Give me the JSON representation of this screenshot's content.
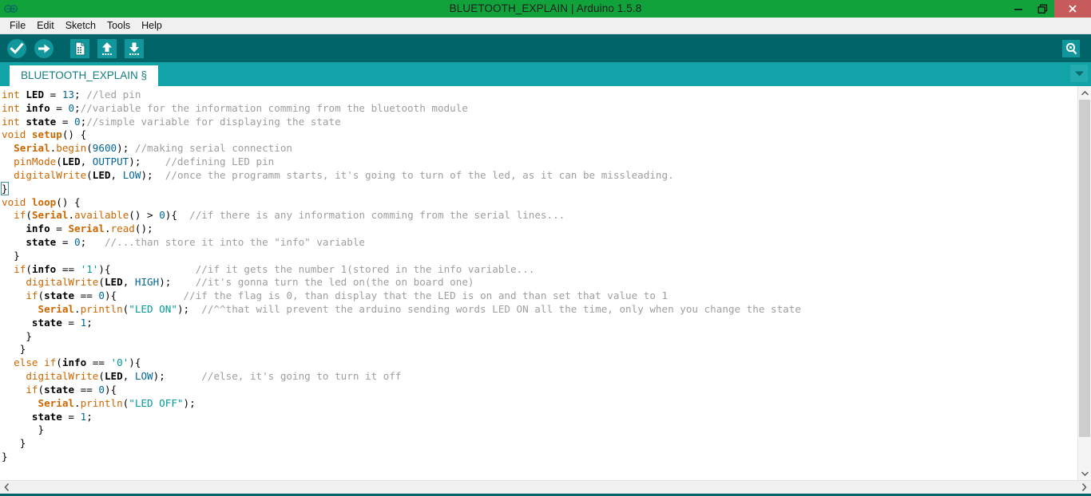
{
  "window": {
    "title": "BLUETOOTH_EXPLAIN | Arduino 1.5.8",
    "titlebar_color": "#11a23c",
    "logo_icon": "arduino-infinity-logo-icon",
    "controls": [
      {
        "name": "minimize",
        "icon": "minimize-icon"
      },
      {
        "name": "restore",
        "icon": "restore-icon"
      },
      {
        "name": "close",
        "icon": "close-icon",
        "color": "#c75b5b"
      }
    ]
  },
  "menubar": {
    "items": [
      {
        "label": "File"
      },
      {
        "label": "Edit"
      },
      {
        "label": "Sketch"
      },
      {
        "label": "Tools"
      },
      {
        "label": "Help"
      }
    ]
  },
  "toolbar": {
    "background": "#006468",
    "buttons": [
      {
        "name": "verify",
        "icon": "check-circle-icon",
        "title": "Verify"
      },
      {
        "name": "upload",
        "icon": "arrow-right-circle-icon",
        "title": "Upload"
      },
      {
        "name": "new",
        "icon": "new-document-icon",
        "title": "New"
      },
      {
        "name": "open",
        "icon": "arrow-up-tray-icon",
        "title": "Open"
      },
      {
        "name": "save",
        "icon": "arrow-down-tray-icon",
        "title": "Save"
      }
    ],
    "serial_monitor": {
      "name": "serial-monitor",
      "icon": "magnifier-icon",
      "title": "Serial Monitor"
    }
  },
  "tabbar": {
    "background": "#12a3a8",
    "tabs": [
      {
        "label": "BLUETOOTH_EXPLAIN §",
        "active": true
      }
    ],
    "dropdown_icon": "chevron-down-icon"
  },
  "editor": {
    "background": "#ffffff",
    "colors": {
      "keyword": "#cc6600",
      "literal": "#006699",
      "string": "#009999",
      "comment": "#9e9e9e",
      "text": "#000000"
    },
    "lines": [
      [
        {
          "t": "int ",
          "c": "kw"
        },
        {
          "t": "LED",
          "c": "plain-b"
        },
        {
          "t": " = ",
          "c": "plain"
        },
        {
          "t": "13",
          "c": "lit"
        },
        {
          "t": "; ",
          "c": "plain"
        },
        {
          "t": "//led pin",
          "c": "cmt"
        }
      ],
      [
        {
          "t": "int ",
          "c": "kw"
        },
        {
          "t": "info",
          "c": "plain-b"
        },
        {
          "t": " = ",
          "c": "plain"
        },
        {
          "t": "0",
          "c": "lit"
        },
        {
          "t": ";",
          "c": "plain"
        },
        {
          "t": "//variable for the information comming from the bluetooth module",
          "c": "cmt"
        }
      ],
      [
        {
          "t": "int ",
          "c": "kw"
        },
        {
          "t": "state",
          "c": "plain-b"
        },
        {
          "t": " = ",
          "c": "plain"
        },
        {
          "t": "0",
          "c": "lit"
        },
        {
          "t": ";",
          "c": "plain"
        },
        {
          "t": "//simple variable for displaying the state",
          "c": "cmt"
        }
      ],
      [
        {
          "t": "void ",
          "c": "kw"
        },
        {
          "t": "setup",
          "c": "kw-b"
        },
        {
          "t": "() {",
          "c": "plain"
        }
      ],
      [
        {
          "t": "  ",
          "c": "plain"
        },
        {
          "t": "Serial",
          "c": "kw-b"
        },
        {
          "t": ".",
          "c": "plain"
        },
        {
          "t": "begin",
          "c": "kw"
        },
        {
          "t": "(",
          "c": "plain"
        },
        {
          "t": "9600",
          "c": "lit"
        },
        {
          "t": "); ",
          "c": "plain"
        },
        {
          "t": "//making serial connection",
          "c": "cmt"
        }
      ],
      [
        {
          "t": "  ",
          "c": "plain"
        },
        {
          "t": "pinMode",
          "c": "kw"
        },
        {
          "t": "(",
          "c": "plain"
        },
        {
          "t": "LED",
          "c": "plain-b"
        },
        {
          "t": ", ",
          "c": "plain"
        },
        {
          "t": "OUTPUT",
          "c": "lit"
        },
        {
          "t": ");    ",
          "c": "plain"
        },
        {
          "t": "//defining LED pin",
          "c": "cmt"
        }
      ],
      [
        {
          "t": "  ",
          "c": "plain"
        },
        {
          "t": "digitalWrite",
          "c": "kw"
        },
        {
          "t": "(",
          "c": "plain"
        },
        {
          "t": "LED",
          "c": "plain-b"
        },
        {
          "t": ", ",
          "c": "plain"
        },
        {
          "t": "LOW",
          "c": "lit"
        },
        {
          "t": ");  ",
          "c": "plain"
        },
        {
          "t": "//once the programm starts, it's going to turn of the led, as it can be missleading.",
          "c": "cmt"
        }
      ],
      [
        {
          "t": "}",
          "c": "plain brkt-sel"
        }
      ],
      [
        {
          "t": "void ",
          "c": "kw"
        },
        {
          "t": "loop",
          "c": "kw-b"
        },
        {
          "t": "() {",
          "c": "plain"
        }
      ],
      [
        {
          "t": "  ",
          "c": "plain"
        },
        {
          "t": "if",
          "c": "kw"
        },
        {
          "t": "(",
          "c": "plain"
        },
        {
          "t": "Serial",
          "c": "kw-b"
        },
        {
          "t": ".",
          "c": "plain"
        },
        {
          "t": "available",
          "c": "kw"
        },
        {
          "t": "() > ",
          "c": "plain"
        },
        {
          "t": "0",
          "c": "lit"
        },
        {
          "t": "){  ",
          "c": "plain"
        },
        {
          "t": "//if there is any information comming from the serial lines...",
          "c": "cmt"
        }
      ],
      [
        {
          "t": "    ",
          "c": "plain"
        },
        {
          "t": "info",
          "c": "plain-b"
        },
        {
          "t": " = ",
          "c": "plain"
        },
        {
          "t": "Serial",
          "c": "kw-b"
        },
        {
          "t": ".",
          "c": "plain"
        },
        {
          "t": "read",
          "c": "kw"
        },
        {
          "t": "();",
          "c": "plain"
        }
      ],
      [
        {
          "t": "    ",
          "c": "plain"
        },
        {
          "t": "state",
          "c": "plain-b"
        },
        {
          "t": " = ",
          "c": "plain"
        },
        {
          "t": "0",
          "c": "lit"
        },
        {
          "t": ";   ",
          "c": "plain"
        },
        {
          "t": "//...than store it into the \"info\" variable",
          "c": "cmt"
        }
      ],
      [
        {
          "t": "  }",
          "c": "plain"
        }
      ],
      [
        {
          "t": "  ",
          "c": "plain"
        },
        {
          "t": "if",
          "c": "kw"
        },
        {
          "t": "(",
          "c": "plain"
        },
        {
          "t": "info",
          "c": "plain-b"
        },
        {
          "t": " == ",
          "c": "plain"
        },
        {
          "t": "'1'",
          "c": "str"
        },
        {
          "t": "){              ",
          "c": "plain"
        },
        {
          "t": "//if it gets the number 1(stored in the info variable...",
          "c": "cmt"
        }
      ],
      [
        {
          "t": "    ",
          "c": "plain"
        },
        {
          "t": "digitalWrite",
          "c": "kw"
        },
        {
          "t": "(",
          "c": "plain"
        },
        {
          "t": "LED",
          "c": "plain-b"
        },
        {
          "t": ", ",
          "c": "plain"
        },
        {
          "t": "HIGH",
          "c": "lit"
        },
        {
          "t": ");    ",
          "c": "plain"
        },
        {
          "t": "//it's gonna turn the led on(the on board one)",
          "c": "cmt"
        }
      ],
      [
        {
          "t": "    ",
          "c": "plain"
        },
        {
          "t": "if",
          "c": "kw"
        },
        {
          "t": "(",
          "c": "plain"
        },
        {
          "t": "state",
          "c": "plain-b"
        },
        {
          "t": " == ",
          "c": "plain"
        },
        {
          "t": "0",
          "c": "lit"
        },
        {
          "t": "){           ",
          "c": "plain"
        },
        {
          "t": "//if the flag is 0, than display that the LED is on and than set that value to 1",
          "c": "cmt"
        }
      ],
      [
        {
          "t": "      ",
          "c": "plain"
        },
        {
          "t": "Serial",
          "c": "kw-b"
        },
        {
          "t": ".",
          "c": "plain"
        },
        {
          "t": "println",
          "c": "kw"
        },
        {
          "t": "(",
          "c": "plain"
        },
        {
          "t": "\"LED ON\"",
          "c": "str"
        },
        {
          "t": ");  ",
          "c": "plain"
        },
        {
          "t": "//^^that will prevent the arduino sending words LED ON all the time, only when you change the state",
          "c": "cmt"
        }
      ],
      [
        {
          "t": "     ",
          "c": "plain"
        },
        {
          "t": "state",
          "c": "plain-b"
        },
        {
          "t": " = ",
          "c": "plain"
        },
        {
          "t": "1",
          "c": "lit"
        },
        {
          "t": ";",
          "c": "plain"
        }
      ],
      [
        {
          "t": "    }",
          "c": "plain"
        }
      ],
      [
        {
          "t": "   }",
          "c": "plain"
        }
      ],
      [
        {
          "t": "  ",
          "c": "plain"
        },
        {
          "t": "else ",
          "c": "kw"
        },
        {
          "t": "if",
          "c": "kw"
        },
        {
          "t": "(",
          "c": "plain"
        },
        {
          "t": "info",
          "c": "plain-b"
        },
        {
          "t": " == ",
          "c": "plain"
        },
        {
          "t": "'0'",
          "c": "str"
        },
        {
          "t": "){",
          "c": "plain"
        }
      ],
      [
        {
          "t": "    ",
          "c": "plain"
        },
        {
          "t": "digitalWrite",
          "c": "kw"
        },
        {
          "t": "(",
          "c": "plain"
        },
        {
          "t": "LED",
          "c": "plain-b"
        },
        {
          "t": ", ",
          "c": "plain"
        },
        {
          "t": "LOW",
          "c": "lit"
        },
        {
          "t": ");      ",
          "c": "plain"
        },
        {
          "t": "//else, it's going to turn it off",
          "c": "cmt"
        }
      ],
      [
        {
          "t": "    ",
          "c": "plain"
        },
        {
          "t": "if",
          "c": "kw"
        },
        {
          "t": "(",
          "c": "plain"
        },
        {
          "t": "state",
          "c": "plain-b"
        },
        {
          "t": " == ",
          "c": "plain"
        },
        {
          "t": "0",
          "c": "lit"
        },
        {
          "t": "){",
          "c": "plain"
        }
      ],
      [
        {
          "t": "      ",
          "c": "plain"
        },
        {
          "t": "Serial",
          "c": "kw-b"
        },
        {
          "t": ".",
          "c": "plain"
        },
        {
          "t": "println",
          "c": "kw"
        },
        {
          "t": "(",
          "c": "plain"
        },
        {
          "t": "\"LED OFF\"",
          "c": "str"
        },
        {
          "t": ");",
          "c": "plain"
        }
      ],
      [
        {
          "t": "     ",
          "c": "plain"
        },
        {
          "t": "state",
          "c": "plain-b"
        },
        {
          "t": " = ",
          "c": "plain"
        },
        {
          "t": "1",
          "c": "lit"
        },
        {
          "t": ";",
          "c": "plain"
        }
      ],
      [
        {
          "t": "      }",
          "c": "plain"
        }
      ],
      [
        {
          "t": "   }",
          "c": "plain"
        }
      ],
      [
        {
          "t": "}",
          "c": "plain"
        }
      ]
    ]
  },
  "scrollbars": {
    "vertical": {
      "up_icon": "chevron-up-icon",
      "down_icon": "chevron-down-icon",
      "thumb_top_pct": 0,
      "thumb_height_pct": 92
    },
    "horizontal": {
      "left_icon": "chevron-left-icon",
      "right_icon": "chevron-right-icon"
    }
  },
  "statusbar": {
    "background": "#006468"
  }
}
